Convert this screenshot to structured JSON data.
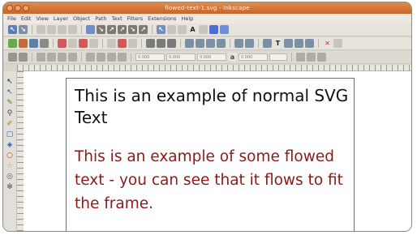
{
  "window": {
    "title": "flowed-text-1.svg - Inkscape"
  },
  "menu": {
    "items": [
      "File",
      "Edit",
      "View",
      "Layer",
      "Object",
      "Path",
      "Text",
      "Filters",
      "Extensions",
      "Help"
    ]
  },
  "toolbar3": {
    "x_value": "0.000",
    "y_value": "0.000",
    "w_value": "0.000",
    "h_value": "0.000"
  },
  "canvas": {
    "normal_text": "This is an example of normal SVG Text",
    "flowed_text": "This is an example of some flowed text - you can see that it flows to fit the frame."
  },
  "colors": {
    "titlebar": "#c7652a",
    "flowed_text": "#8b1a1a",
    "normal_text": "#111111"
  }
}
